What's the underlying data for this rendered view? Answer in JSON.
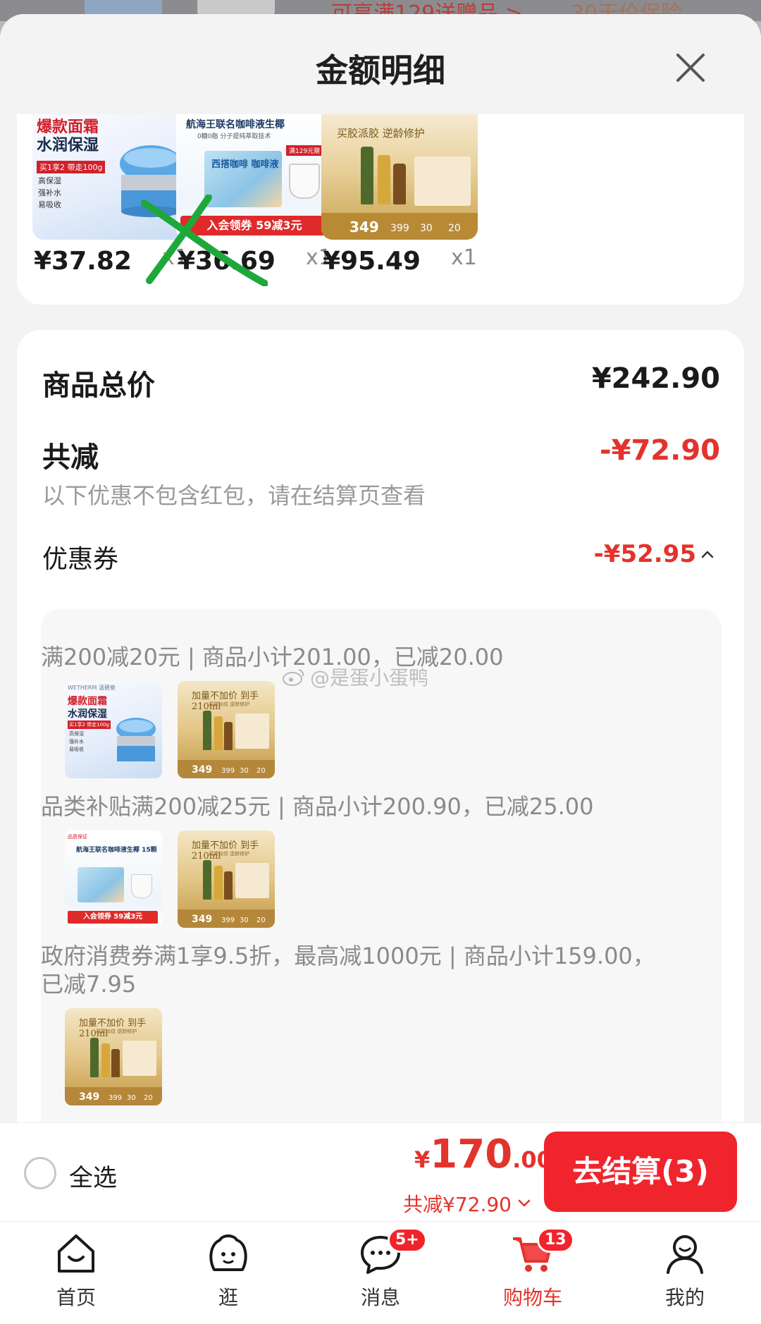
{
  "backdrop": {
    "promo_text": "可享满129送赠品 >",
    "promo_text2": "30天价保险"
  },
  "sheet": {
    "title": "金额明细",
    "close_icon": "close-icon"
  },
  "products": [
    {
      "name": "cream",
      "price": "¥37.82",
      "qty": "x1",
      "img_line1": "爆款面霜",
      "img_line2": "水润保湿",
      "img_tag": "买1享2 带走100g",
      "img_list": [
        "高保湿",
        "强补水",
        "易吸收"
      ]
    },
    {
      "name": "coffee",
      "price": "¥36.69",
      "qty": "x1",
      "img_title": "航海王联名咖啡液生椰",
      "img_sub": "0糖0脂 分子提纯萃取技术",
      "img_box": "西搭咖啡 咖啡液",
      "img_badge": "满129元赠",
      "img_ribbon": "入会领券 59减3元"
    },
    {
      "name": "gold-set",
      "price": "¥95.49",
      "qty": "x1",
      "img_caption": "买胶派胶 逆龄修护",
      "img_p1": "349",
      "img_p2": "399",
      "img_p3": "30",
      "img_p4": "20"
    }
  ],
  "summary": {
    "total_label": "商品总价",
    "total_amount": "¥242.90",
    "discount_label": "共减",
    "discount_amount": "-¥72.90",
    "hint": "以下优惠不包含红包，请在结算页查看",
    "coupon_label": "优惠券",
    "coupon_amount": "-¥52.95"
  },
  "coupons": [
    {
      "text": "满200减20元 | 商品小计201.00，已减20.00"
    },
    {
      "text": "品类补贴满200减25元 | 商品小计200.90，已减25.00"
    },
    {
      "text": "政府消费券满1享9.5折，最高减1000元 | 商品小计159.00，已减7.95"
    }
  ],
  "thumbs": {
    "cream": {
      "brand": "WETHERM 温碧泉",
      "l1": "爆款面霜",
      "l2": "水润保湿",
      "tag": "买1享2 带走100g",
      "list": [
        "高保湿",
        "强补水",
        "易吸收"
      ]
    },
    "gold": {
      "caption": "加量不加价 到手210ml",
      "sub": "紧致淡纹 逆龄修护",
      "p1": "349",
      "p2": "399",
      "p3": "30",
      "p4": "20"
    },
    "coffee": {
      "title": "航海王联名咖啡液生椰 15颗",
      "top": "品质保证",
      "ribbon": "入会领券 59减3元"
    }
  },
  "watermark": "@是蛋小蛋鸭",
  "checkout": {
    "select_all": "全选",
    "total_yen": "¥",
    "total_int": "170",
    "total_dec": ".00",
    "total_sub": "共减¥72.90",
    "button": "去结算(3)"
  },
  "nav": [
    {
      "label": "首页",
      "icon": "home-icon"
    },
    {
      "label": "逛",
      "icon": "browse-icon"
    },
    {
      "label": "消息",
      "icon": "message-icon",
      "badge": "5+"
    },
    {
      "label": "购物车",
      "icon": "cart-icon",
      "badge": "13",
      "active": true
    },
    {
      "label": "我的",
      "icon": "profile-icon"
    }
  ],
  "colors": {
    "accent_red": "#e4322c",
    "button_red": "#f0242c",
    "annotation_green": "#1ea83a"
  }
}
